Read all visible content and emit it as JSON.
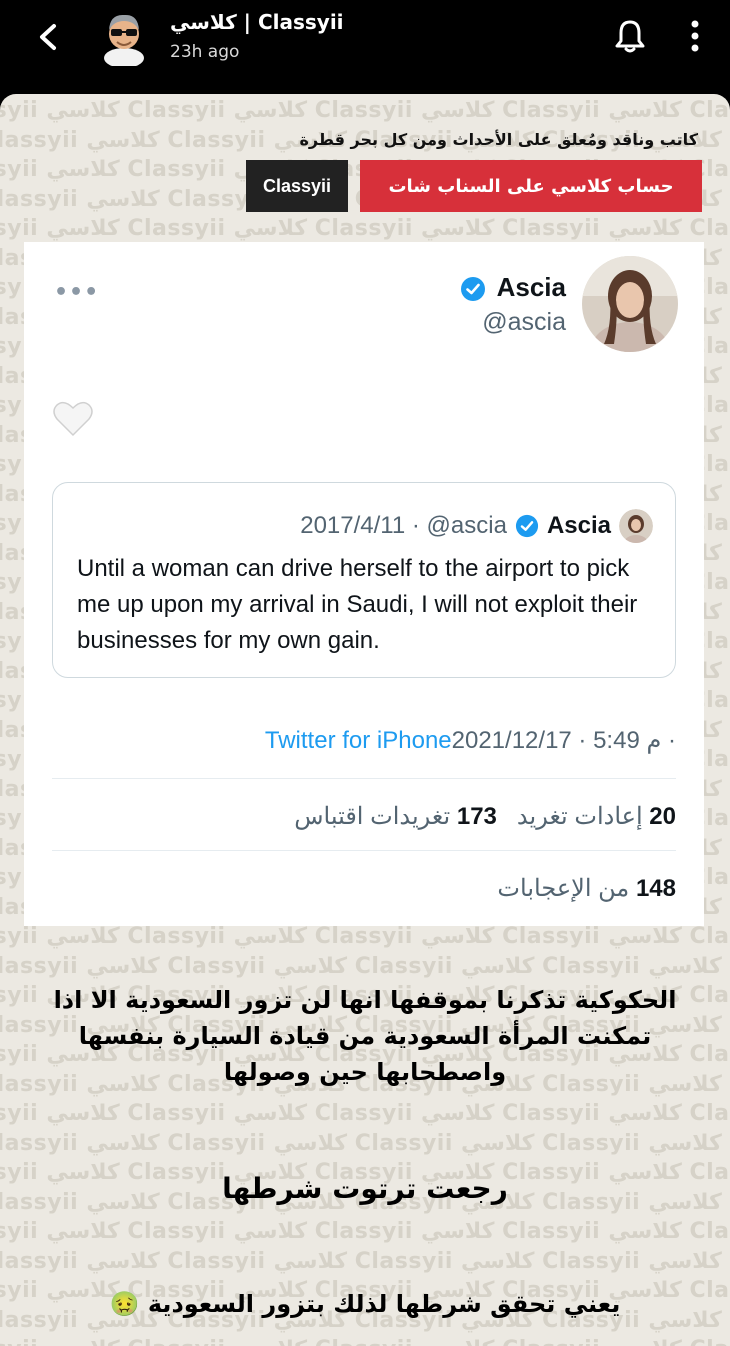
{
  "story": {
    "username": "كلاسي | Classyii",
    "time": "23h ago"
  },
  "header": {
    "tagline": "كاتب وناقد ومُعلق على الأحداث ومن كل بحر قطرة",
    "red_badge": "حساب كلاسي على السناب شات",
    "dark_badge": "Classyii"
  },
  "watermark": "Classyii كلاسي",
  "tweet": {
    "name": "Ascia",
    "handle": "@ascia",
    "quote": {
      "name": "Ascia",
      "handle_date": "2017/4/11 · @ascia",
      "text": "Until a woman can drive herself to the airport to pick me up upon my arrival in Saudi, I will not exploit their businesses for my own gain."
    },
    "date_time": "2021/12/17 · 5:49 م · ",
    "source": "Twitter for iPhone",
    "retweets_count": "20",
    "retweets_label": "إعادات تغريد",
    "quotes_count": "173",
    "quotes_label": "تغريدات اقتباس",
    "likes_count": "148",
    "likes_label": "من الإعجابات"
  },
  "captions": {
    "line1": "الحكوكية تذكرنا بموقفها انها لن تزور السعودية الا اذا تمكنت المرأة السعودية من قيادة السيارة بنفسها واصطحابها حين وصولها",
    "line2": "رجعت ترتوت شرطها",
    "line3": "يعني تحقق شرطها لذلك بتزور السعودية 🤢"
  },
  "colors": {
    "red": "#d7303a",
    "dark": "#222222",
    "twitter_blue": "#1d9bf0"
  }
}
